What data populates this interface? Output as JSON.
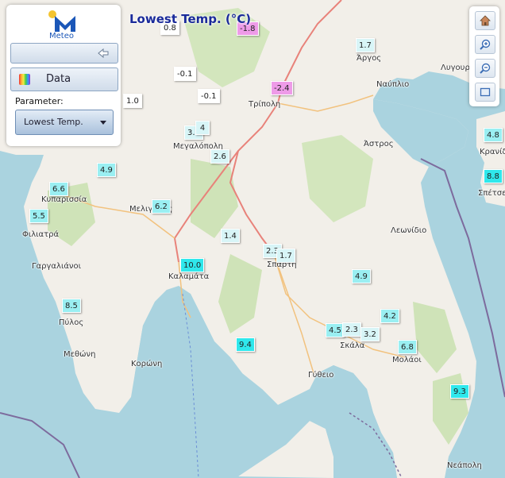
{
  "title": "Lowest Temp. (°C)",
  "panel": {
    "logo_text": "Meteo",
    "data_label": "Data",
    "parameter_label": "Parameter:",
    "parameter_value": "Lowest Temp."
  },
  "toolbar": {
    "items": [
      "home-icon",
      "zoom-in-icon",
      "zoom-out-icon",
      "zoom-extent-icon"
    ]
  },
  "colors": {
    "sea": "#aad3df",
    "land": "#f2efe9",
    "forest": "#c8dfae",
    "road_primary": "#e8827a",
    "road_secondary": "#f2c27e",
    "border": "#7d6b9d",
    "title": "#1a2a9a",
    "marker_cold": "#ee9be8",
    "marker_mild": "#d8f5f7",
    "marker_warm": "#2fe8ec"
  },
  "places": [
    "Κυπαρισσία",
    "Φιλιατρά",
    "Γαργαλιάνοι",
    "Πύλος",
    "Μεθώνη",
    "Κορώνη",
    "Μελιγαλάς",
    "Μεγαλόπολη",
    "Καλαμάτα",
    "Τρίπολη",
    "Άργος",
    "Ναύπλιο",
    "Λυγουριό",
    "Άστρος",
    "Λεωνίδιο",
    "Σπάρτη",
    "Σκάλα",
    "Γύθειο",
    "Μολάοι",
    "Νεάπολη",
    "Κρανίδι",
    "Σπέτσες"
  ],
  "stations": [
    {
      "value": "0.8",
      "level": "white"
    },
    {
      "value": "-1.8",
      "level": "pink"
    },
    {
      "value": "-0.1",
      "level": "white"
    },
    {
      "value": "-0.1",
      "level": "white"
    },
    {
      "value": "1.0",
      "level": "white"
    },
    {
      "value": "-2.4",
      "level": "pink"
    },
    {
      "value": "1.7",
      "level": "pale"
    },
    {
      "value": "3.8",
      "level": "pale"
    },
    {
      "value": "4",
      "level": "pale"
    },
    {
      "value": "2.6",
      "level": "pale"
    },
    {
      "value": "4.9",
      "level": "cyan"
    },
    {
      "value": "6.6",
      "level": "cyan"
    },
    {
      "value": "5.5",
      "level": "cyan"
    },
    {
      "value": "6.2",
      "level": "cyan"
    },
    {
      "value": "1.4",
      "level": "pale"
    },
    {
      "value": "2.3",
      "level": "pale"
    },
    {
      "value": "1.7",
      "level": "pale"
    },
    {
      "value": "10.0",
      "level": "bright"
    },
    {
      "value": "4.9",
      "level": "cyan"
    },
    {
      "value": "8.5",
      "level": "cyan"
    },
    {
      "value": "4.2",
      "level": "cyan"
    },
    {
      "value": "4.5",
      "level": "cyan"
    },
    {
      "value": "2.3",
      "level": "pale"
    },
    {
      "value": "3.2",
      "level": "pale"
    },
    {
      "value": "9.4",
      "level": "bright"
    },
    {
      "value": "6.8",
      "level": "cyan"
    },
    {
      "value": "9.3",
      "level": "bright"
    },
    {
      "value": "4.8",
      "level": "cyan"
    },
    {
      "value": "8.8",
      "level": "bright"
    }
  ]
}
